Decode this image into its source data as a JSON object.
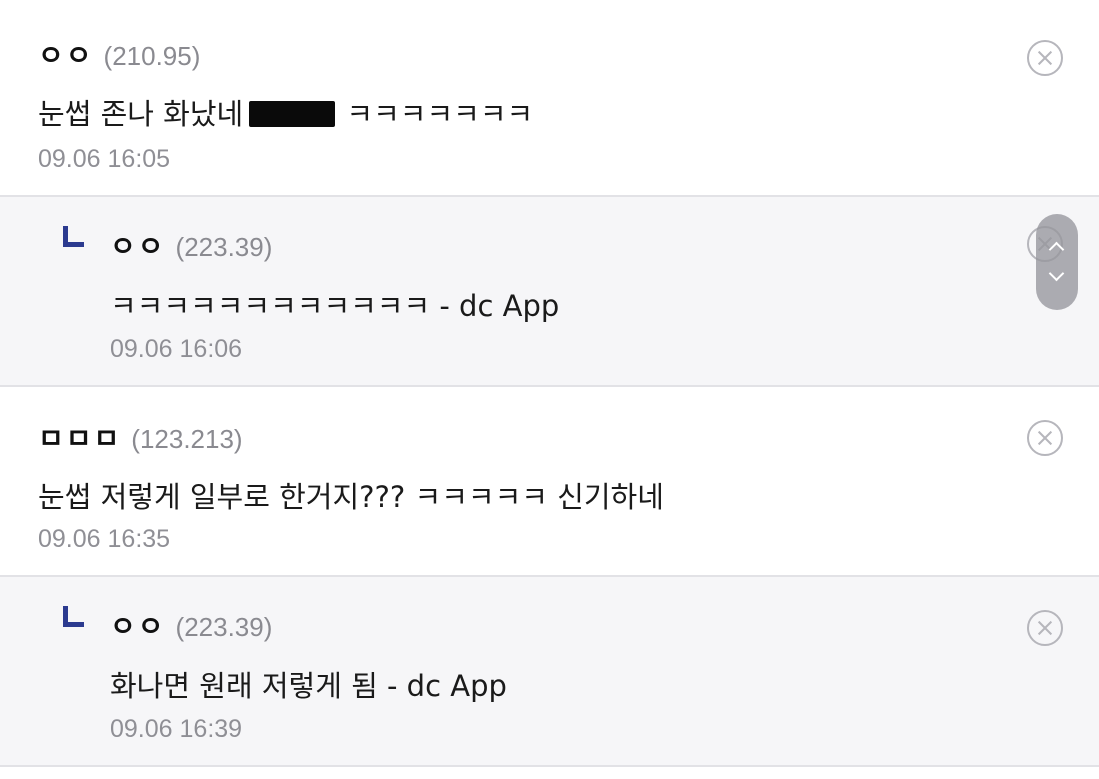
{
  "comments": [
    {
      "nick": "ㅇㅇ",
      "ip": "(210.95)",
      "text_before": "눈썹 존나 화났네",
      "text_after": " ㅋㅋㅋㅋㅋㅋㅋ",
      "date": "09.06 16:05",
      "is_reply": false
    },
    {
      "nick": "ㅇㅇ",
      "ip": "(223.39)",
      "text": "ㅋㅋㅋㅋㅋㅋㅋㅋㅋㅋㅋㅋ - dc App",
      "date": "09.06 16:06",
      "is_reply": true
    },
    {
      "nick": "ㅁㅁㅁ",
      "ip": "(123.213)",
      "text": "눈썹 저렇게 일부로 한거지??? ㅋㅋㅋㅋㅋ 신기하네",
      "date": "09.06 16:35",
      "is_reply": false
    },
    {
      "nick": "ㅇㅇ",
      "ip": "(223.39)",
      "text": "화나면 원래 저렇게 됨 - dc App",
      "date": "09.06 16:39",
      "is_reply": true
    }
  ],
  "icons": {
    "delete": "close-circle-icon",
    "reply": "reply-corner-icon",
    "scroll_up": "chevron-up-icon",
    "scroll_down": "chevron-down-icon"
  },
  "colors": {
    "reply_background": "#f6f6f8",
    "reply_mark": "#2b3a8f",
    "divider": "#e2e2e6",
    "meta_gray": "#8f8f95"
  }
}
